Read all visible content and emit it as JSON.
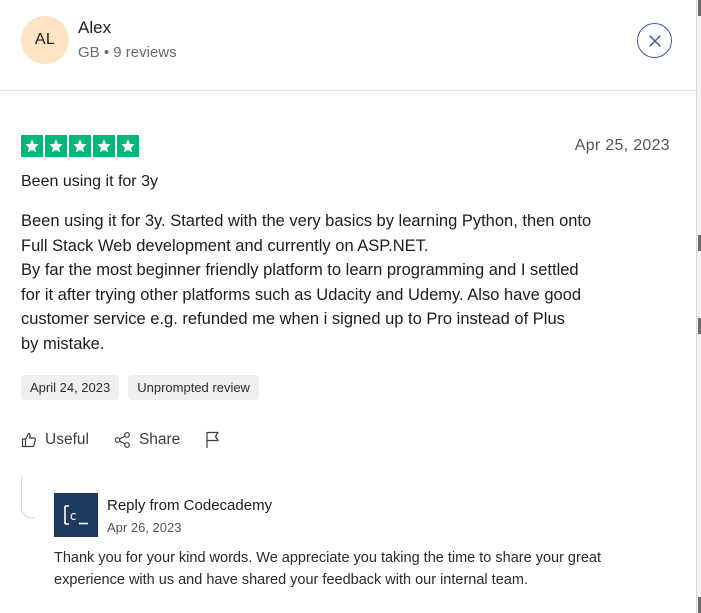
{
  "reviewer": {
    "initials": "AL",
    "name": "Alex",
    "meta": "GB • 9 reviews"
  },
  "review": {
    "rating": 5,
    "date": "Apr 25, 2023",
    "title": "Been using it for 3y",
    "lines": [
      "Been using it for 3y. Started with the very basics by learning Python, then onto",
      "Full Stack Web development and currently on ASP.NET.",
      "By far the most beginner friendly platform to learn programming and I settled",
      "for it after trying other platforms such as Udacity and Udemy. Also have good",
      "customer service e.g. refunded me when i signed up to Pro instead of Plus",
      "by mistake."
    ],
    "tags": [
      "April 24, 2023",
      "Unprompted review"
    ]
  },
  "actions": {
    "useful_label": "Useful",
    "share_label": "Share"
  },
  "reply": {
    "logo_text": "[c_",
    "from": "Reply from Codecademy",
    "date": "Apr 26, 2023",
    "lines": [
      "Thank you for your kind words. We appreciate you taking the time to share your great",
      "experience with us and have shared your feedback with our internal team."
    ]
  },
  "colors": {
    "star_green": "#00b67a",
    "avatar_bg": "#fde5c4",
    "close_blue": "#3b5998",
    "logo_bg": "#1f3a5f"
  }
}
